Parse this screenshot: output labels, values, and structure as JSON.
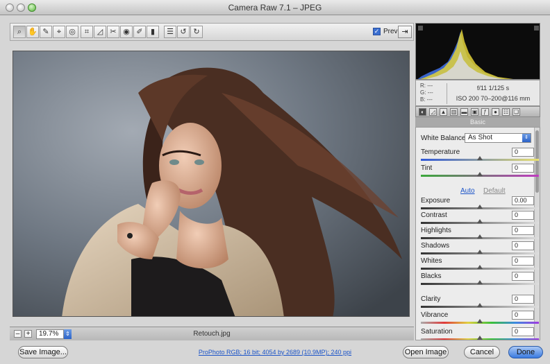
{
  "window": {
    "title": "Camera Raw 7.1  –  JPEG"
  },
  "toolbar": {
    "tools": [
      {
        "name": "zoom-tool",
        "glyph": "⌕"
      },
      {
        "name": "hand-tool",
        "glyph": "✋"
      },
      {
        "name": "white-balance-tool",
        "glyph": "✎"
      },
      {
        "name": "color-sampler-tool",
        "glyph": "⌖"
      },
      {
        "name": "targeted-adjustment-tool",
        "glyph": "◎"
      },
      {
        "name": "crop-tool",
        "glyph": "⌗"
      },
      {
        "name": "straighten-tool",
        "glyph": "◿"
      },
      {
        "name": "spot-removal-tool",
        "glyph": "✂"
      },
      {
        "name": "red-eye-tool",
        "glyph": "◉"
      },
      {
        "name": "adjustment-brush-tool",
        "glyph": "✐"
      },
      {
        "name": "graduated-filter-tool",
        "glyph": "▮"
      },
      {
        "name": "preferences-button",
        "glyph": "☰"
      },
      {
        "name": "rotate-ccw-button",
        "glyph": "↺"
      },
      {
        "name": "rotate-cw-button",
        "glyph": "↻"
      }
    ],
    "preview_label": "Preview",
    "preview_checked": true,
    "fullscreen_glyph": "⇥"
  },
  "image_bar": {
    "zoom": "19.7%",
    "filename": "Retouch.jpg"
  },
  "info": {
    "r": "R:  ---",
    "g": "G:  ---",
    "b": "B:  ---",
    "exif_line1": "f/11   1/125 s",
    "exif_line2": "ISO 200   70–200@116 mm"
  },
  "panel": {
    "title": "Basic",
    "white_balance_label": "White Balance:",
    "white_balance_value": "As Shot",
    "auto_label": "Auto",
    "default_label": "Default",
    "sliders": [
      {
        "label": "Temperature",
        "value": "0",
        "pos": 0.5,
        "track": "temp"
      },
      {
        "label": "Tint",
        "value": "0",
        "pos": 0.5,
        "track": "tint"
      },
      {
        "label": "Exposure",
        "value": "0.00",
        "pos": 0.5,
        "track": ""
      },
      {
        "label": "Contrast",
        "value": "0",
        "pos": 0.5,
        "track": ""
      },
      {
        "label": "Highlights",
        "value": "0",
        "pos": 0.5,
        "track": ""
      },
      {
        "label": "Shadows",
        "value": "0",
        "pos": 0.5,
        "track": ""
      },
      {
        "label": "Whites",
        "value": "0",
        "pos": 0.5,
        "track": ""
      },
      {
        "label": "Blacks",
        "value": "0",
        "pos": 0.5,
        "track": ""
      },
      {
        "label": "Clarity",
        "value": "0",
        "pos": 0.5,
        "track": ""
      },
      {
        "label": "Vibrance",
        "value": "0",
        "pos": 0.5,
        "track": "vib"
      },
      {
        "label": "Saturation",
        "value": "0",
        "pos": 0.5,
        "track": "vib"
      }
    ]
  },
  "footer": {
    "save_image": "Save Image...",
    "workflow_link": "ProPhoto RGB; 16 bit; 4054 by 2689 (10.9MP); 240 ppi",
    "open_image": "Open Image",
    "cancel": "Cancel",
    "done": "Done"
  },
  "colors": {
    "accent": "#3a7ae0",
    "link": "#1a53c8"
  }
}
